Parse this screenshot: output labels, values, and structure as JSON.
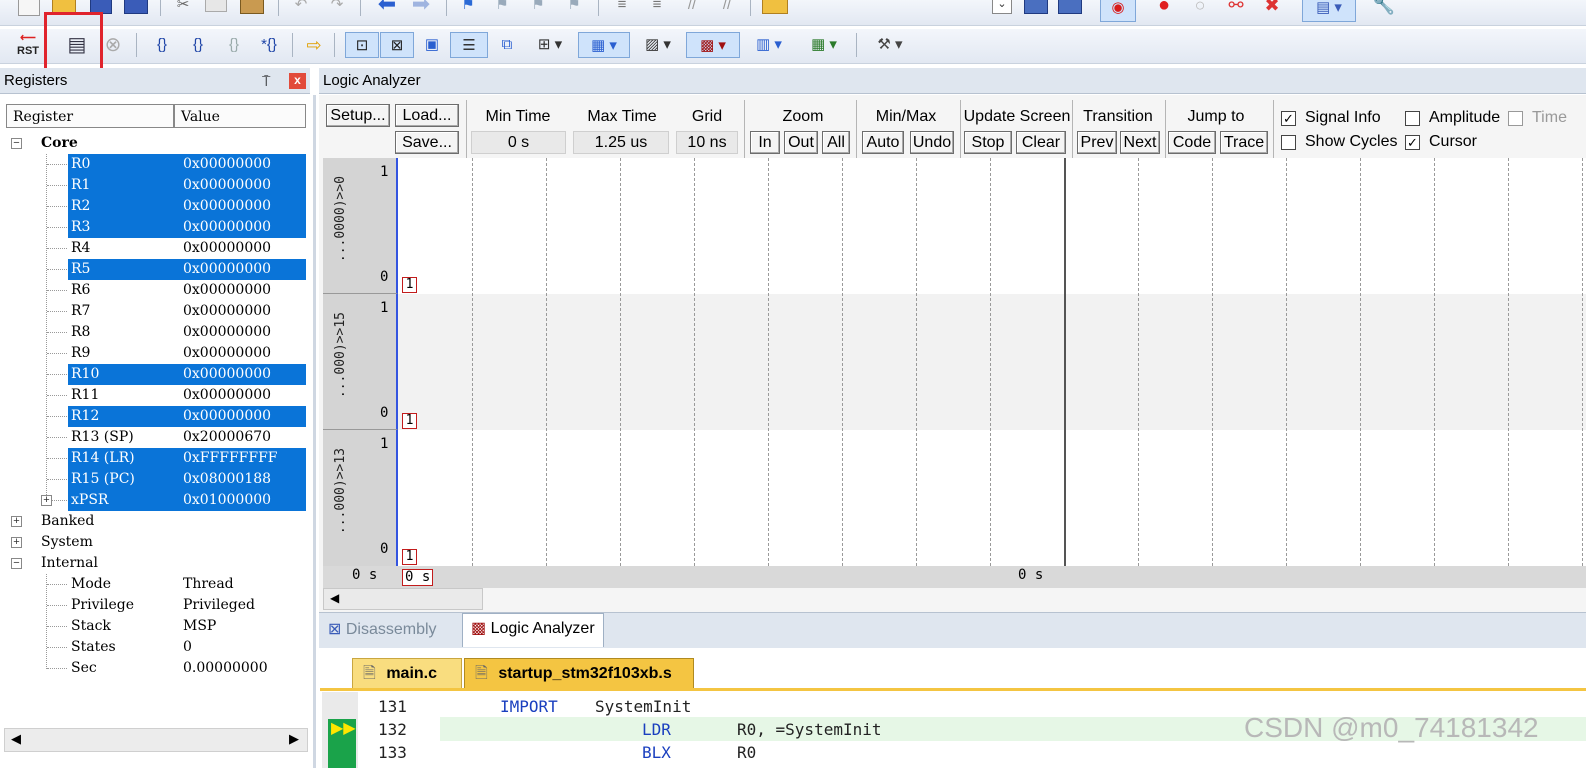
{
  "toolbar": {
    "rst_label": "RST"
  },
  "registers": {
    "title": "Registers",
    "pin_glyph": "⍑",
    "close_glyph": "x",
    "col_register": "Register",
    "col_value": "Value",
    "core_label": "Core",
    "core": [
      {
        "name": "R0",
        "value": "0x00000000",
        "sel": true
      },
      {
        "name": "R1",
        "value": "0x00000000",
        "sel": true
      },
      {
        "name": "R2",
        "value": "0x00000000",
        "sel": true
      },
      {
        "name": "R3",
        "value": "0x00000000",
        "sel": true
      },
      {
        "name": "R4",
        "value": "0x00000000",
        "sel": false
      },
      {
        "name": "R5",
        "value": "0x00000000",
        "sel": true
      },
      {
        "name": "R6",
        "value": "0x00000000",
        "sel": false
      },
      {
        "name": "R7",
        "value": "0x00000000",
        "sel": false
      },
      {
        "name": "R8",
        "value": "0x00000000",
        "sel": false
      },
      {
        "name": "R9",
        "value": "0x00000000",
        "sel": false
      },
      {
        "name": "R10",
        "value": "0x00000000",
        "sel": true
      },
      {
        "name": "R11",
        "value": "0x00000000",
        "sel": false
      },
      {
        "name": "R12",
        "value": "0x00000000",
        "sel": true
      },
      {
        "name": "R13 (SP)",
        "value": "0x20000670",
        "sel": false
      },
      {
        "name": "R14 (LR)",
        "value": "0xFFFFFFFF",
        "sel": true
      },
      {
        "name": "R15 (PC)",
        "value": "0x08000188",
        "sel": true
      },
      {
        "name": "xPSR",
        "value": "0x01000000",
        "sel": true
      }
    ],
    "groups": [
      "Banked",
      "System",
      "Internal"
    ],
    "internal": [
      {
        "name": "Mode",
        "value": "Thread"
      },
      {
        "name": "Privilege",
        "value": "Privileged"
      },
      {
        "name": "Stack",
        "value": "MSP"
      },
      {
        "name": "States",
        "value": "0"
      },
      {
        "name": "Sec",
        "value": "0.00000000"
      }
    ]
  },
  "la": {
    "title": "Logic Analyzer",
    "setup": "Setup...",
    "load": "Load...",
    "save": "Save...",
    "min_time_label": "Min Time",
    "min_time": "0 s",
    "max_time_label": "Max Time",
    "max_time": "1.25 us",
    "grid_label": "Grid",
    "grid": "10 ns",
    "zoom_label": "Zoom",
    "zoom_in": "In",
    "zoom_out": "Out",
    "zoom_all": "All",
    "minmax_label": "Min/Max",
    "auto": "Auto",
    "undo": "Undo",
    "update_label": "Update Screen",
    "stop": "Stop",
    "clear": "Clear",
    "transition_label": "Transition",
    "prev": "Prev",
    "next": "Next",
    "jump_label": "Jump to",
    "code": "Code",
    "trace": "Trace",
    "signal_info": "Signal Info",
    "show_cycles": "Show Cycles",
    "amplitude": "Amplitude",
    "cursor": "Cursor",
    "time_cut": "Time",
    "checks": {
      "signal_info": true,
      "show_cycles": false,
      "amplitude": false,
      "cursor": true,
      "time": false
    },
    "signals": [
      {
        "name": "...0000)>>0",
        "hi": "1",
        "lo": "0",
        "marker": "1"
      },
      {
        "name": "...000)>>15",
        "hi": "1",
        "lo": "0",
        "marker": "1"
      },
      {
        "name": "...000)>>13",
        "hi": "1",
        "lo": "0",
        "marker": "1"
      }
    ],
    "time_left": "0 s",
    "time_cursor": "0 s",
    "time_mid": "0 s"
  },
  "tabs": {
    "disassembly": "Disassembly",
    "logic": "Logic Analyzer"
  },
  "files": {
    "main": "main.c",
    "startup": "startup_stm32f103xb.s"
  },
  "code": [
    {
      "line": "131",
      "instr": "IMPORT",
      "arg": "SystemInit"
    },
    {
      "line": "132",
      "instr": "LDR",
      "arg": "R0, =SystemInit"
    },
    {
      "line": "133",
      "instr": "BLX",
      "arg": "R0"
    }
  ],
  "watermark": "CSDN @m0_74181342"
}
